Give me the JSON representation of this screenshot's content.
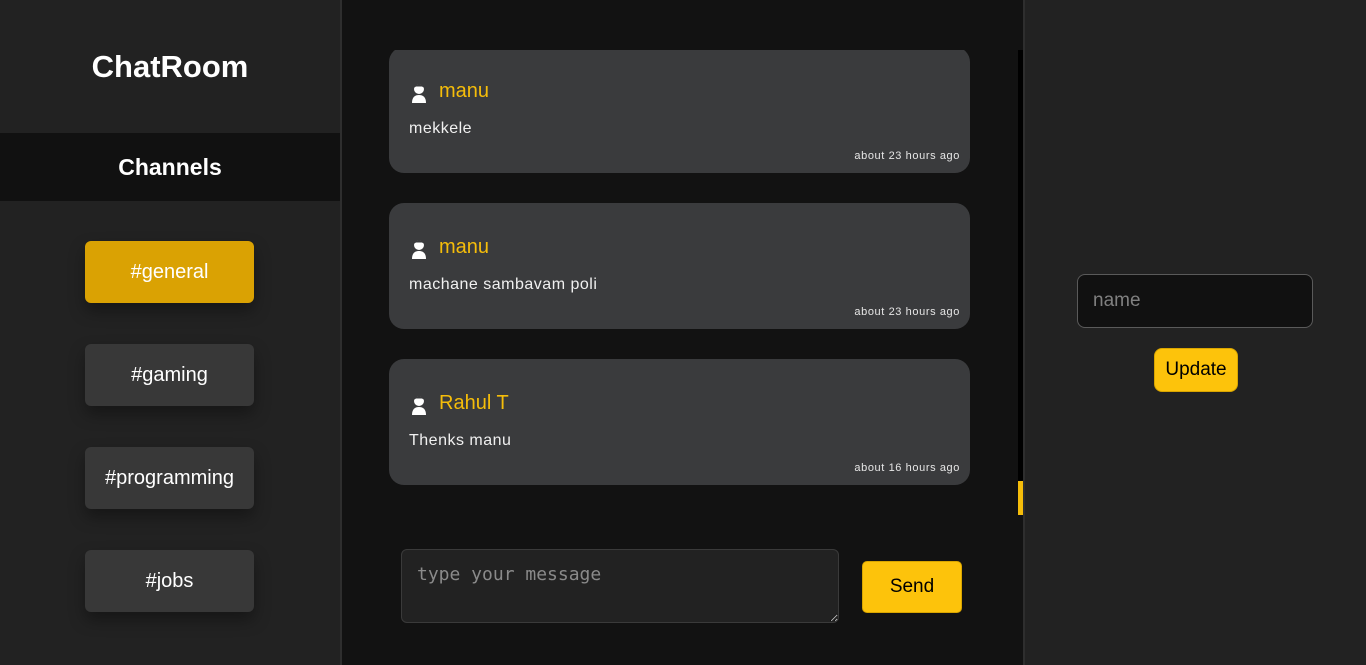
{
  "app": {
    "title": "ChatRoom",
    "accent_color": "#fdc30b"
  },
  "sidebar": {
    "channels_header": "Channels",
    "channels": [
      {
        "label": "#general",
        "active": true
      },
      {
        "label": "#gaming",
        "active": false
      },
      {
        "label": "#programming",
        "active": false
      },
      {
        "label": "#jobs",
        "active": false
      }
    ]
  },
  "messages": [
    {
      "user": "manu",
      "avatar_icon": "user-avatar-icon",
      "text": "mekkele",
      "time": "about 23 hours ago"
    },
    {
      "user": "manu",
      "avatar_icon": "user-avatar-icon",
      "text": "machane sambavam poli",
      "time": "about 23 hours ago"
    },
    {
      "user": "Rahul T",
      "avatar_icon": "user-avatar-icon",
      "text": "Thenks manu",
      "time": "about 16 hours ago"
    }
  ],
  "composer": {
    "placeholder": "type your message",
    "value": "",
    "send_label": "Send"
  },
  "profile": {
    "name_placeholder": "name",
    "name_value": "",
    "update_label": "Update"
  }
}
